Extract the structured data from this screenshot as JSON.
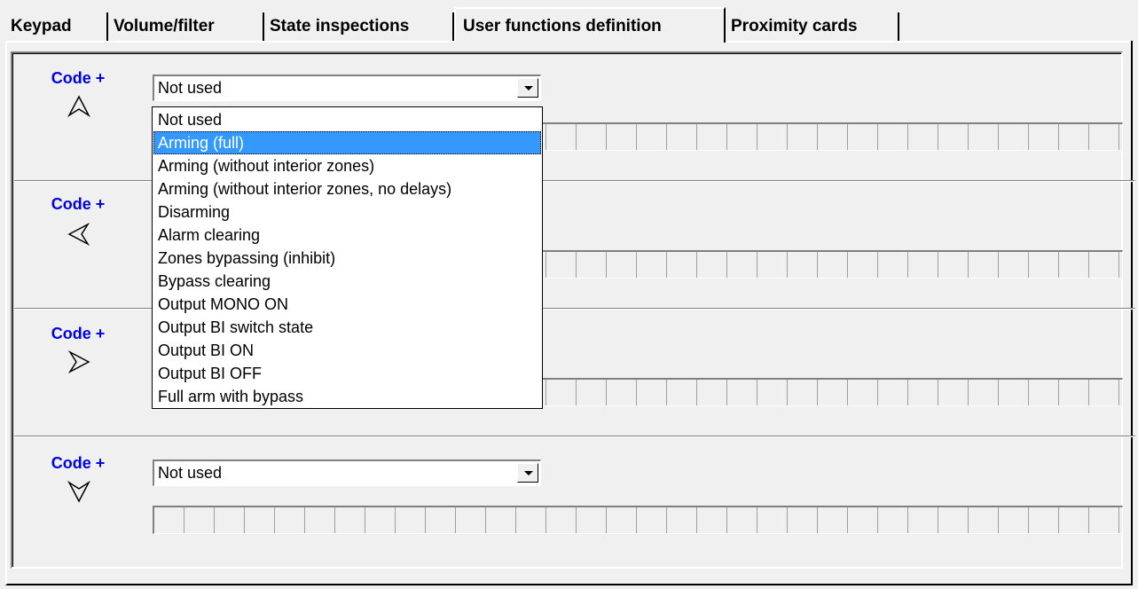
{
  "tabs": [
    {
      "label": "Keypad"
    },
    {
      "label": "Volume/filter"
    },
    {
      "label": "State inspections"
    },
    {
      "label": "User functions definition",
      "active": true
    },
    {
      "label": "Proximity cards"
    }
  ],
  "groups": [
    {
      "code_label": "Code +",
      "arrow_icon": "arrow-up-icon",
      "select_value": "Not used"
    },
    {
      "code_label": "Code +",
      "arrow_icon": "arrow-left-icon",
      "select_value": ""
    },
    {
      "code_label": "Code +",
      "arrow_icon": "arrow-right-icon",
      "select_value": ""
    },
    {
      "code_label": "Code +",
      "arrow_icon": "arrow-down-icon",
      "select_value": "Not used"
    }
  ],
  "dropdown": {
    "options": [
      "Not used",
      "Arming (full)",
      "Arming (without interior zones)",
      "Arming (without interior zones, no delays)",
      "Disarming",
      "Alarm clearing",
      "Zones bypassing (inhibit)",
      "Bypass clearing",
      "Output MONO ON",
      "Output BI switch state",
      "Output BI ON",
      "Output BI OFF",
      "Full arm with bypass"
    ],
    "highlighted": "Arming (full)"
  },
  "colors": {
    "code_label": "#0000e6",
    "highlight": "#3399ff",
    "background": "#f0f0f0"
  }
}
